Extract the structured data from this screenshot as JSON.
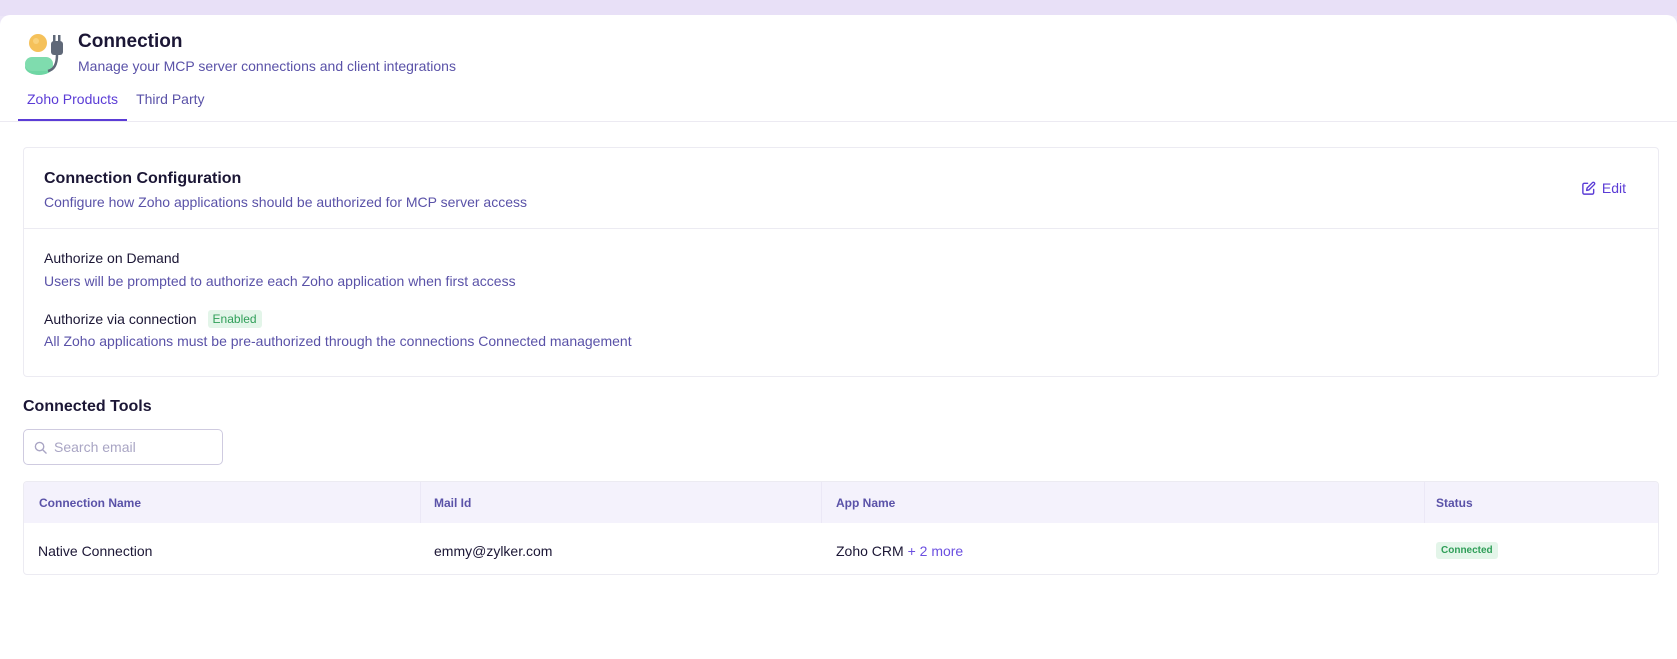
{
  "header": {
    "title": "Connection",
    "subtitle": "Manage your MCP server connections and client integrations"
  },
  "tabs": [
    {
      "label": "Zoho Products",
      "active": true
    },
    {
      "label": "Third Party",
      "active": false
    }
  ],
  "config": {
    "title": "Connection Configuration",
    "subtitle": "Configure how Zoho applications should be authorized for MCP server access",
    "edit_label": "Edit",
    "options": [
      {
        "title": "Authorize on Demand",
        "description": "Users will be prompted to authorize each Zoho application when first access",
        "badge": ""
      },
      {
        "title": "Authorize via connection",
        "description": "All Zoho applications must be pre-authorized through the connections Connected management",
        "badge": "Enabled"
      }
    ]
  },
  "tools": {
    "title": "Connected Tools",
    "search_placeholder": "Search email",
    "columns": [
      "Connection Name",
      "Mail Id",
      "App Name",
      "Status"
    ],
    "rows": [
      {
        "connection_name": "Native Connection",
        "mail_id": "emmy@zylker.com",
        "app_name": "Zoho CRM",
        "more": "+ 2 more",
        "status": "Connected"
      }
    ]
  },
  "colors": {
    "accent": "#5b3cd6",
    "secondary_text": "#5a52a8",
    "success": "#2f9e58",
    "success_bg": "#e3f5e9",
    "header_bg": "#f4f2fc"
  },
  "icons": [
    "user-plug-icon",
    "edit-icon",
    "search-icon"
  ]
}
